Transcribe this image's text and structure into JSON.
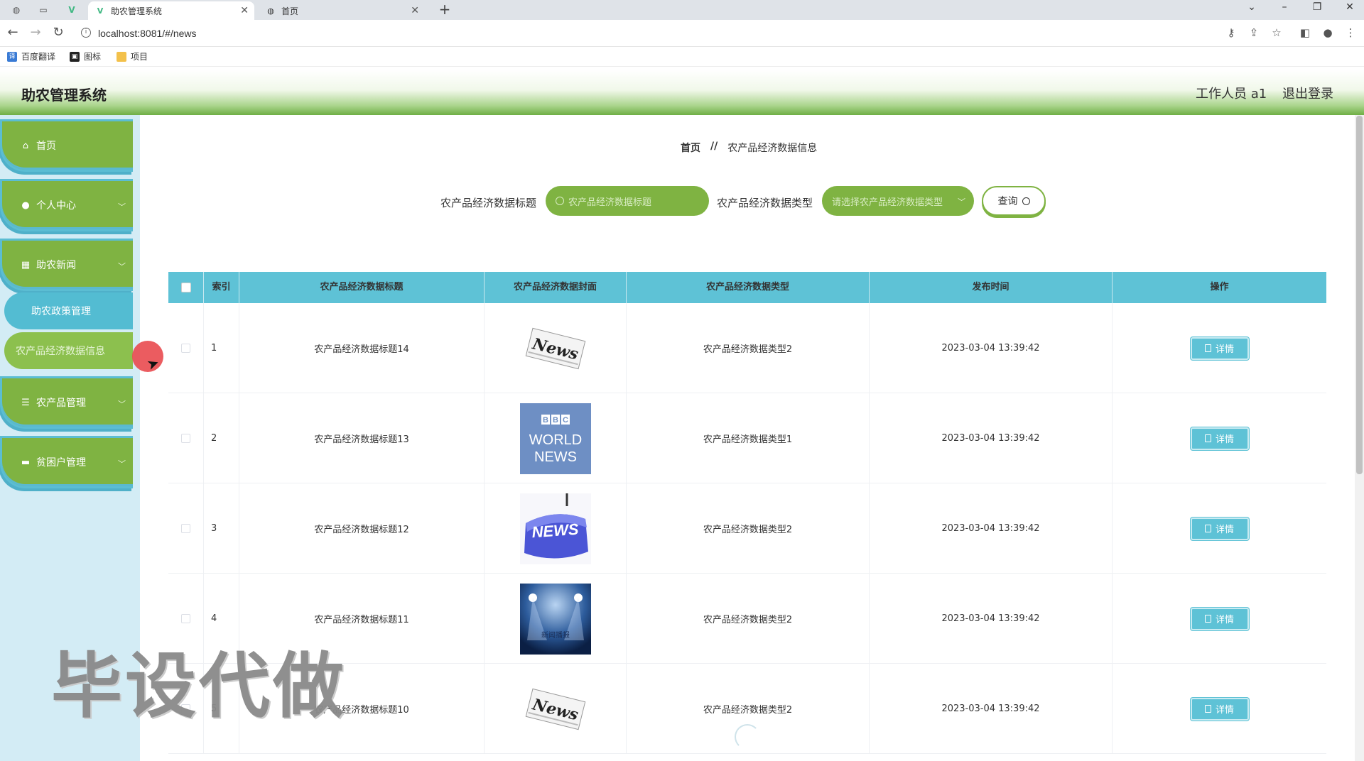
{
  "browser": {
    "tabs": [
      {
        "title": "助农管理系统",
        "active": true
      },
      {
        "title": "首页",
        "active": false
      }
    ],
    "url": "localhost:8081/#/news",
    "bookmarks": [
      {
        "label": "百度翻译"
      },
      {
        "label": "图标"
      },
      {
        "label": "项目"
      }
    ]
  },
  "header": {
    "title": "助农管理系统",
    "user": "工作人员 a1",
    "logout": "退出登录"
  },
  "sidebar": {
    "items": [
      {
        "label": "首页",
        "icon": "home-icon"
      },
      {
        "label": "个人中心",
        "icon": "user-icon"
      },
      {
        "label": "助农新闻",
        "icon": "grid-icon"
      },
      {
        "label": "农产品管理",
        "icon": "list-icon"
      },
      {
        "label": "贫困户管理",
        "icon": "monitor-icon"
      }
    ],
    "submenu": [
      {
        "label": "助农政策管理"
      },
      {
        "label": "农产品经济数据信息"
      }
    ]
  },
  "breadcrumb": {
    "home": "首页",
    "separator": "//",
    "current": "农产品经济数据信息"
  },
  "search": {
    "title_label": "农产品经济数据标题",
    "title_placeholder": "农产品经济数据标题",
    "type_label": "农产品经济数据类型",
    "type_placeholder": "请选择农产品经济数据类型",
    "button": "查询"
  },
  "table": {
    "headers": {
      "index": "索引",
      "title": "农产品经济数据标题",
      "cover": "农产品经济数据封面",
      "type": "农产品经济数据类型",
      "time": "发布时间",
      "action": "操作"
    },
    "rows": [
      {
        "index": "1",
        "title": "农产品经济数据标题14",
        "cover": "News",
        "type": "农产品经济数据类型2",
        "time": "2023-03-04 13:39:42",
        "action": "详情"
      },
      {
        "index": "2",
        "title": "农产品经济数据标题13",
        "cover": "BBC WORLD NEWS",
        "type": "农产品经济数据类型1",
        "time": "2023-03-04 13:39:42",
        "action": "详情"
      },
      {
        "index": "3",
        "title": "农产品经济数据标题12",
        "cover": "NEWS",
        "type": "农产品经济数据类型2",
        "time": "2023-03-04 13:39:42",
        "action": "详情"
      },
      {
        "index": "4",
        "title": "农产品经济数据标题11",
        "cover": "新闻播报",
        "type": "农产品经济数据类型2",
        "time": "2023-03-04 13:39:42",
        "action": "详情"
      },
      {
        "index": "5",
        "title": "农产品经济数据标题10",
        "cover": "News",
        "type": "农产品经济数据类型2",
        "time": "2023-03-04 13:39:42",
        "action": "详情"
      }
    ]
  },
  "watermark": "毕设代做",
  "colors": {
    "green": "#7fb342",
    "teal": "#5ec2d6",
    "sidebar_bg": "#d3ecf5"
  }
}
